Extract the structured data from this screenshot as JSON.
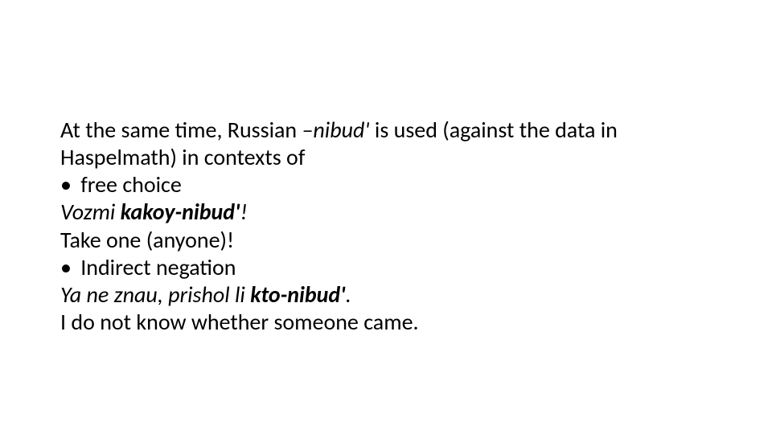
{
  "lines": {
    "intro_pre": "At the same time, Russian ",
    "intro_emdash_term": "–nibud'",
    "intro_post": " is used (against the data in Haspelmath) in contexts of",
    "bullet1": "free choice",
    "ex1_pre": "Vozmi ",
    "ex1_bold": "kakoy-nibud'",
    "ex1_post": "!",
    "ex1_gloss": "Take one (anyone)!",
    "bullet2": "Indirect negation",
    "ex2_pre": "Ya ne znau, prishol li ",
    "ex2_bold": "kto-nibud'",
    "ex2_post": ".",
    "ex2_gloss": "I do not know whether someone came.",
    "bullet_glyph": "•"
  }
}
